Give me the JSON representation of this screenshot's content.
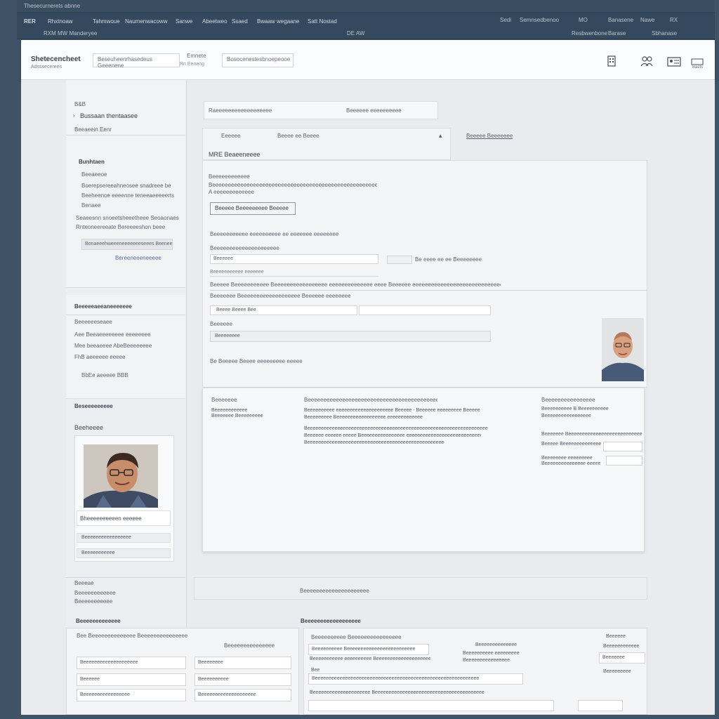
{
  "topbar": {
    "app_title": "Thesecurnerets abnne",
    "left_id": "RER",
    "nav": [
      "Rhxtnoaw",
      "Tahmwoue",
      "Naumenwacoww",
      "Sanwe",
      "Abeetweo",
      "Ssaed",
      "Bwaaw wegaane",
      "Satt Nostad"
    ],
    "center_sub": "DE AW",
    "left_sub": "RXM  MW  Manderyee",
    "right": [
      "Sedi",
      "Semnsedbenoo",
      "MO",
      "Banasene",
      "Nawe",
      "RX"
    ],
    "right_sub": [
      "Resbwenbone",
      "Barase",
      "Sbhanase"
    ]
  },
  "header": {
    "brand": "Shetecencheet",
    "brand_sub": "Adsssecerees",
    "field1": "Beseuheenrhasedeus Geeenene",
    "field2": "Emnete",
    "field2_sub": "Rn   Eeneng",
    "field3": "Bosocenestesbnoepeooe",
    "icons": [
      "building-icon",
      "people-icon",
      "id-card-icon",
      "badge-icon"
    ],
    "right_label": "Baets"
  },
  "left_panel": {
    "top_label": "B&B",
    "name": "Bussaan thentaasee",
    "name_sub": "Beeaeein Eenr",
    "section_label": "Bunhtaen",
    "items": [
      "Beeaeeoe",
      "Boerepsereeahneosee snadreee be",
      "Beeheenoe eeeenne teneeaeeeeerts",
      "Benaee",
      "Seaeesnn snoeetsheeetheee Seoaonaes",
      "Rnteoneereeate  Bereeeeshon beee"
    ],
    "button": "Bonaeeehweeeneeeeeeeseees  Beeneee",
    "link": "Bereeneeeneeeee",
    "group2_title": "Beeeeeaeeaneeeeeee",
    "group2_items": [
      "Beeeeeeseaee",
      "Aee  Beeaeeeeeeee  eeeeeeee",
      "Mee beeaeeee  AbeBeeeeeeee",
      "FhB aeeeeee  eeeee"
    ],
    "group2_link": "BbEe aeeeee BBB",
    "group3_title": "Beseeeeeeeee",
    "photo_label": "Beeheeee",
    "photo_caption": "Bheeeeeeeeeen eeeeee",
    "photo_line1": "Beeeeeeeeeeeeeeeee",
    "photo_line2": "Beeeeeeeeeee",
    "footer_items": [
      "Beeeae",
      "Beeeeeeeeeeee",
      "Beeeeeeeeeee"
    ]
  },
  "content": {
    "search_left": "Raeeeeeeeeeeeeeeeeee",
    "search_right": "Beeeeee eeeeeeeeee",
    "tabs": [
      "Eeeeee",
      "Beeee  ee  Beeee"
    ],
    "section_label": "Beeeee   Beeeeeee",
    "card_title": "MRE  Beaeeneeee",
    "desc_title": "Beeeeeeeeeeee",
    "desc_line1": "Beeeeeeeeeeeeeeeeeeeeeeeeeeeeeeeeeeeeeeeeeeeeeeeeeeeeeeeeeeee",
    "desc_line2": "A eeeeeeeeeeeee",
    "card_button": "Beeeee Beeeeeeeee Beeeee",
    "form_title": "Beeeeeeeeeee eeeeeeeeee ee eeeeeee eeeeeeee",
    "field1_label": "Beeeeeeeeeeeeeeeeeeeee",
    "field1_value": "Beeeeee",
    "field1_side": "Be eeee ee ee Beeeeeeee",
    "field1_note": "Beeeeeeeeeee eeeeeee",
    "long_line": "Beeeee Beeeeeeeeeee  Beeeeeeeeeeeeeeeee eeeeeeeeeeeeee eeee  Beeeeee  eeeeeeeeeeeeeeeeeeeeeeeeeeeeeeeeeeeeeee",
    "field2_label": "Beeeeeee Beeeeeeeeeeeeeeeeeee  Beeeeee eeeeeeeeeeee",
    "field2_value": "Beeee   Beeee  Bee",
    "field3_label": "Beeeeee",
    "field3_value": "Beeeeeeee",
    "footer_line": "Be Beeeee  Beeee eeeeeeeee eeeee",
    "detail_left": [
      "Beeeeeee",
      "Beeeeeeeeeeee",
      "Beeeeeee  Beeeeeeeee"
    ],
    "detail_mid_title": "Beeeeeeeeeeeeeeeeeeeeeeeeeeeeeeeeeeeeeeeeeee",
    "detail_mid_lines": [
      "Beeeeeeeeee eeeeeeeeeeeeeeeeeeeee  Beeeee  -  Beeeeee eeeeeeeee  Beeeee",
      "Beeeeeeeee                              Beeeeeeeeeeeeeeeeee  eeeeeeeeeeeee",
      "Beeeeeeeeeeeeeeeeeeeeeeeeeeeeeeeeeeeeeeeeeeeeeeeeeeeeeeeeeeeeeeeeeeeeee",
      "Beeeeee eeeeee eeeee  Beeeeeeeeeeeeeeee eeeeeeeeeeeeeeeeeeeeeeeeeeeee",
      "Beeeeeeeeeeeeeeeeeeeeeeeeeeeeeeeeeeeeeeeeeeeeeeeeeeeeeeeeeeee"
    ],
    "detail_right_title": "Beeeeeeeeeeeeeeee",
    "detail_right_lines": [
      "Beeeeeeeeee  B  Beeeeeeeeee",
      "Beeeeeeeeeeeeeeeee",
      "Beeeeeee  Beeeeeeeeeeeeeeeeeeeeeeeeeee",
      "Beeeee   Beeeeeeeeeeeeee",
      "Beeeeeeee  eeeeeeeee",
      "Beeeeeeeeeeeeeee  eeeee"
    ],
    "lower_label": "Beeeeeeeeeeeeeeeeeeeee",
    "bottom_section": "Beeeeeeeeeeeeeeeeee",
    "bottom_left_title": "Beeeeeeeeeeeee",
    "bottom_table_head": [
      "Bee  Beeeeeeeeeeeeee  Beeeeeeeeeeeeeee eeeeeeeeeeeeee",
      "Beeeeeeeeeeeeeee"
    ],
    "bottom_rows": [
      [
        "Beeeeeeeeeeeeeeeeeeee",
        "Beeeeeeee"
      ],
      [
        "Beeeeee",
        "Beeeeeeeeee"
      ],
      [
        "Beeeeeeeeeeeeeeeee",
        "Beeeeeeeeeeeeeeeeeeee"
      ]
    ],
    "bottom_mid": [
      "Beeeeeeeeee  Beeeeeeeeeeeeeeee",
      "Beeeeeeeeee  Beeeeeeeeeeeeeeeeeeeeeeeee",
      "Beeeeeeeeeee  eeeeeeeeee  Beeeeeeeeeeeeeeeeeeeeeeee",
      "Bee",
      "Beeeeeeeeeeeeeeeeeeeeeeeeeeeeeeeeeeeeeeeeeeeeeeeeeeeeeeeeeeee",
      "Beeeeeeeeeeeeeeeeeeeee  Beeeeeeeeeeeeeeeeeeeeeeeeeeeeeeeeeeeeeeee"
    ],
    "bottom_right": [
      "Beeeeeeeeeeeeee",
      "Beeeeeeeeee  eeeeeeeee",
      "Beeeeeeeeeeeeeeee",
      "Beeeeee",
      "Beeeeeeeeeeee",
      "Beeeeeee",
      "Beeeeeeeee"
    ]
  },
  "colors": {
    "chrome": "#34495d",
    "header": "#fbfcfd",
    "panel": "#f4f5f7",
    "border": "#d9dce0"
  }
}
